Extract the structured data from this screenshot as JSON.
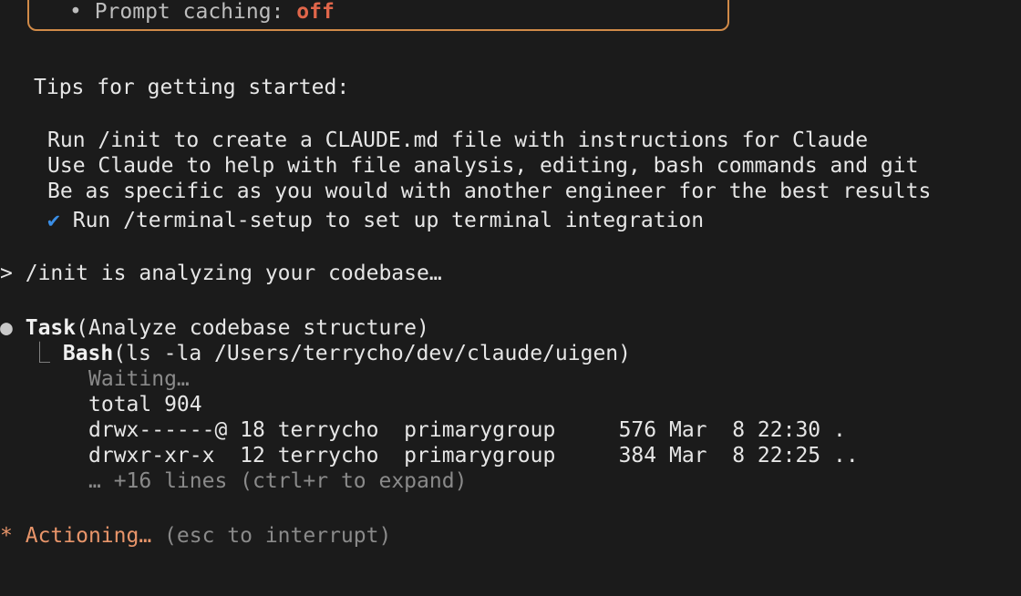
{
  "top_box": {
    "clipped_label": "• Prompt caching: ",
    "clipped_value": "off"
  },
  "tips": {
    "heading": "Tips for getting started:",
    "items": [
      "Run /init to create a CLAUDE.md file with instructions for Claude",
      "Use Claude to help with file analysis, editing, bash commands and git",
      "Be as specific as you would with another engineer for the best results"
    ],
    "done_item": {
      "check": "✔",
      "text": "Run /terminal-setup to set up terminal integration"
    }
  },
  "prompt": {
    "marker": ">",
    "text": "/init is analyzing your codebase…"
  },
  "task": {
    "bullet": "●",
    "tool": "Task",
    "args": "(Analyze codebase structure)",
    "sub": {
      "branch": "⎿",
      "tool": "Bash",
      "args": "(ls -la /Users/terrycho/dev/claude/uigen)",
      "status": "Waiting…",
      "output": [
        "total 904",
        "drwx------@ 18 terrycho  primarygroup     576 Mar  8 22:30 .",
        "drwxr-xr-x  12 terrycho  primarygroup     384 Mar  8 22:25 .."
      ],
      "more": "… +16 lines (ctrl+r to expand)"
    }
  },
  "status": {
    "spinner": "*",
    "label": "Actioning…",
    "hint": " (esc to interrupt)"
  },
  "colors": {
    "background": "#1b1b1b",
    "border": "#d08a48",
    "check": "#3a8ee6",
    "accent": "#e8956a"
  }
}
